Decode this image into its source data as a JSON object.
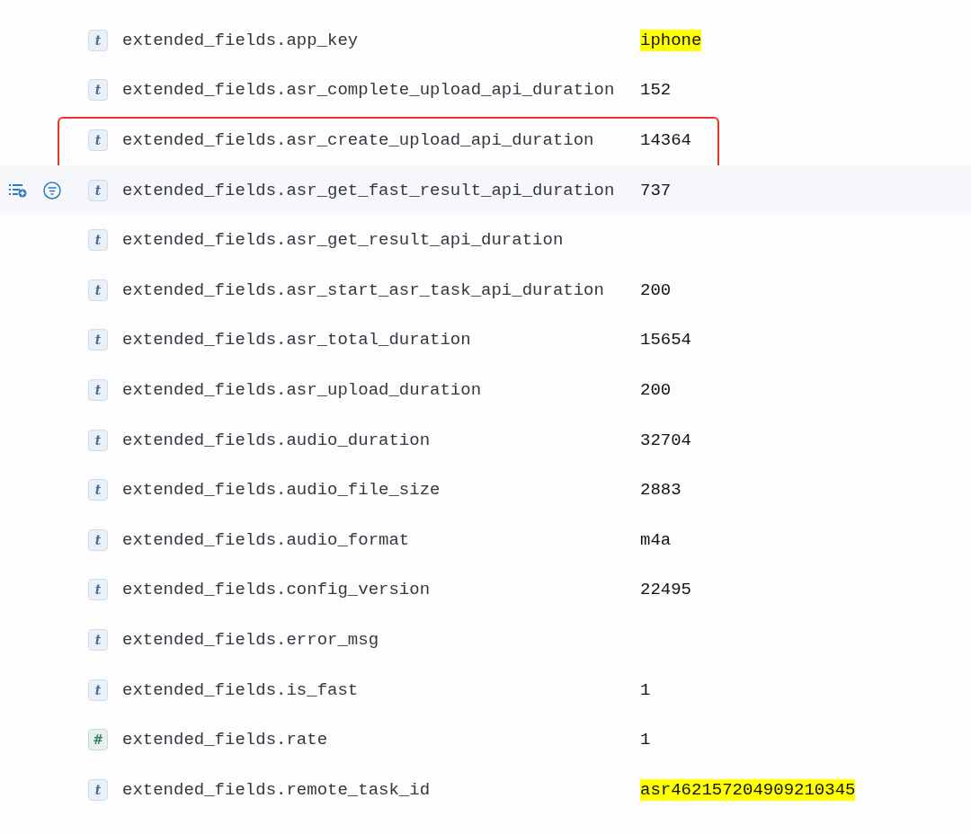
{
  "rows": [
    {
      "type": "t",
      "name": "extended_fields.app_key",
      "value": "iphone",
      "highlighted": true,
      "hovered": false,
      "outlined": false
    },
    {
      "type": "t",
      "name": "extended_fields.asr_complete_upload_api_duration",
      "value": "152",
      "highlighted": false,
      "hovered": false,
      "outlined": false
    },
    {
      "type": "t",
      "name": "extended_fields.asr_create_upload_api_duration",
      "value": "14364",
      "highlighted": false,
      "hovered": false,
      "outlined": true
    },
    {
      "type": "t",
      "name": "extended_fields.asr_get_fast_result_api_duration",
      "value": "737",
      "highlighted": false,
      "hovered": true,
      "outlined": false
    },
    {
      "type": "t",
      "name": "extended_fields.asr_get_result_api_duration",
      "hovered": false,
      "outlined": false
    },
    {
      "type": "t",
      "name": "extended_fields.asr_start_asr_task_api_duration",
      "value": "200",
      "highlighted": false,
      "hovered": false,
      "outlined": false
    },
    {
      "type": "t",
      "name": "extended_fields.asr_total_duration",
      "value": "15654",
      "highlighted": false,
      "hovered": false,
      "outlined": false
    },
    {
      "type": "t",
      "name": "extended_fields.asr_upload_duration",
      "value": "200",
      "highlighted": false,
      "hovered": false,
      "outlined": false
    },
    {
      "type": "t",
      "name": "extended_fields.audio_duration",
      "value": "32704",
      "highlighted": false,
      "hovered": false,
      "outlined": false
    },
    {
      "type": "t",
      "name": "extended_fields.audio_file_size",
      "value": "2883",
      "highlighted": false,
      "hovered": false,
      "outlined": false
    },
    {
      "type": "t",
      "name": "extended_fields.audio_format",
      "value": "m4a",
      "highlighted": false,
      "hovered": false,
      "outlined": false
    },
    {
      "type": "t",
      "name": "extended_fields.config_version",
      "value": "22495",
      "highlighted": false,
      "hovered": false,
      "outlined": false
    },
    {
      "type": "t",
      "name": "extended_fields.error_msg",
      "hovered": false,
      "outlined": false
    },
    {
      "type": "t",
      "name": "extended_fields.is_fast",
      "value": "1",
      "highlighted": false,
      "hovered": false,
      "outlined": false
    },
    {
      "type": "#",
      "name": "extended_fields.rate",
      "value": "1",
      "highlighted": false,
      "hovered": false,
      "outlined": false
    },
    {
      "type": "t",
      "name": "extended_fields.remote_task_id",
      "value": "asr462157204909210345",
      "highlighted": true,
      "hovered": false,
      "outlined": false
    }
  ]
}
